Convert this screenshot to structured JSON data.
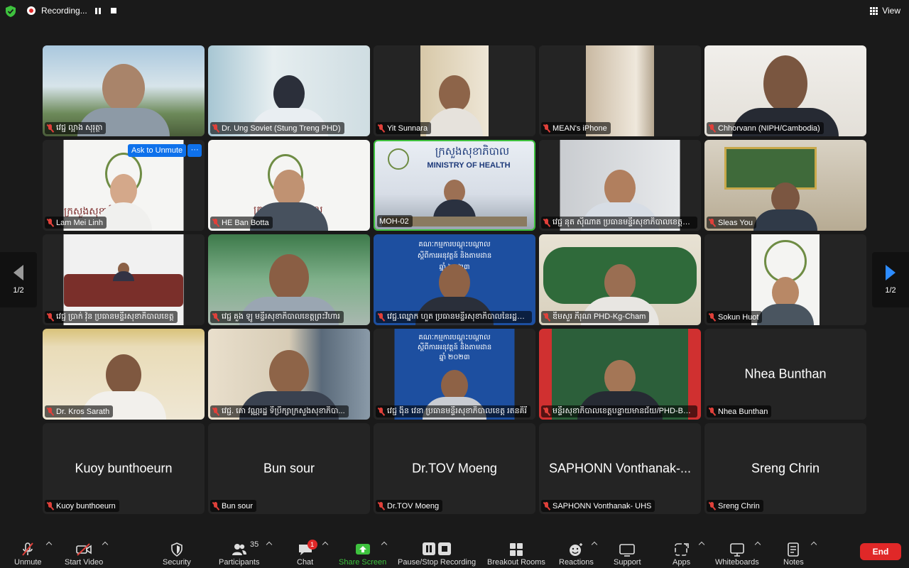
{
  "topbar": {
    "recording_label": "Recording...",
    "view_label": "View"
  },
  "participants": [
    {
      "label": "វេជ្ជ ល្អាង សុរុត្ថា"
    },
    {
      "label": "Dr. Ung Soviet (Stung Treng PHD)"
    },
    {
      "label": "Yit Sunnara"
    },
    {
      "label": "MEAN's iPhone"
    },
    {
      "label": "Chhorvann (NIPH/Cambodia)"
    },
    {
      "label": "Lam Mei Linh",
      "ask_unmute": "Ask to Unmute",
      "more": "···",
      "bg_text": "ក្រសួងសុខាភិបាល"
    },
    {
      "label": "HE Ban Botta",
      "bg_text": "ក្រសួងសុខាភិបាល"
    },
    {
      "label": "MOH-02",
      "bg_text_km": "ក្រសួងសុខាភិបាល",
      "bg_text_en": "MINISTRY OF HEALTH"
    },
    {
      "label": "វេជ្ជ នុត សុីណាត ប្រធានមន្ទីរសុខាភិបាលខេត្តតា..."
    },
    {
      "label": "Sleas You"
    },
    {
      "label": "វេជ្ជ ប្រាក់ វ៉ុន ប្រធានមន្ទីរសុខាភិបាលខេត្ត"
    },
    {
      "label": "វេជ្ជ គួង ឡូ មន្ទីរសុខាភិបាលខេត្តព្រះវិហារ"
    },
    {
      "label": "វេជ្ជ.ឈ្នោក ហួត ប្រធានមន្ទីរសុខាភិបាលនៃរដ្ឋបា...",
      "banner": [
        "គណៈកម្មការបណ្តុះបណ្តាល",
        "ស្តីពីការអនុវត្តន៍ និងតាមដាន",
        "ឆ្នាំ ២០២៣"
      ]
    },
    {
      "label": "ឌឹមសួរ ភីរុណ PHD-Kg-Cham"
    },
    {
      "label": "Sokun Huot"
    },
    {
      "label": "Dr. Kros Sarath"
    },
    {
      "label": "វេជ្ជ. គោ វណ្ណរដ្ឋ ទីប្រឹក្សាក្រសួងសុខាភិបា..."
    },
    {
      "label": "វេជ្ជ ង៉ិន វេនា ប្រធានមន្ទីរសុខាភិបាលខេត្ត រតនគិរី",
      "banner": [
        "គណៈកម្មការបណ្តុះបណ្តាល",
        "ស្តីពីការអនុវត្តន៍ និងតាមដាន",
        "ឆ្នាំ ២០២៣"
      ]
    },
    {
      "label": "មន្ទីរសុខាភិបាលខេត្តបន្ទាយមានជ័យ/PHD-BMC"
    },
    {
      "label": "Nhea Bunthan",
      "center": "Nhea Bunthan"
    },
    {
      "label": "Kuoy bunthoeurn",
      "center": "Kuoy bunthoeurn"
    },
    {
      "label": "Bun sour",
      "center": "Bun sour"
    },
    {
      "label": "Dr.TOV Moeng",
      "center": "Dr.TOV Moeng"
    },
    {
      "label": "SAPHONN Vonthanak- UHS",
      "center": "SAPHONN Vonthanak-..."
    },
    {
      "label": "Sreng Chrin",
      "center": "Sreng Chrin"
    }
  ],
  "pager": {
    "left": "1/2",
    "right": "1/2"
  },
  "toolbar": {
    "unmute": "Unmute",
    "start_video": "Start Video",
    "security": "Security",
    "participants": "Participants",
    "participants_count": "35",
    "chat": "Chat",
    "chat_badge": "1",
    "share_screen": "Share Screen",
    "pause_stop": "Pause/Stop Recording",
    "breakout": "Breakout Rooms",
    "reactions": "Reactions",
    "support": "Support",
    "apps": "Apps",
    "whiteboards": "Whiteboards",
    "notes": "Notes",
    "end": "End"
  },
  "colors": {
    "accent": "#0e71eb",
    "active_speaker": "#3ec23e",
    "end": "#e02828",
    "muted": "#e0403a"
  }
}
